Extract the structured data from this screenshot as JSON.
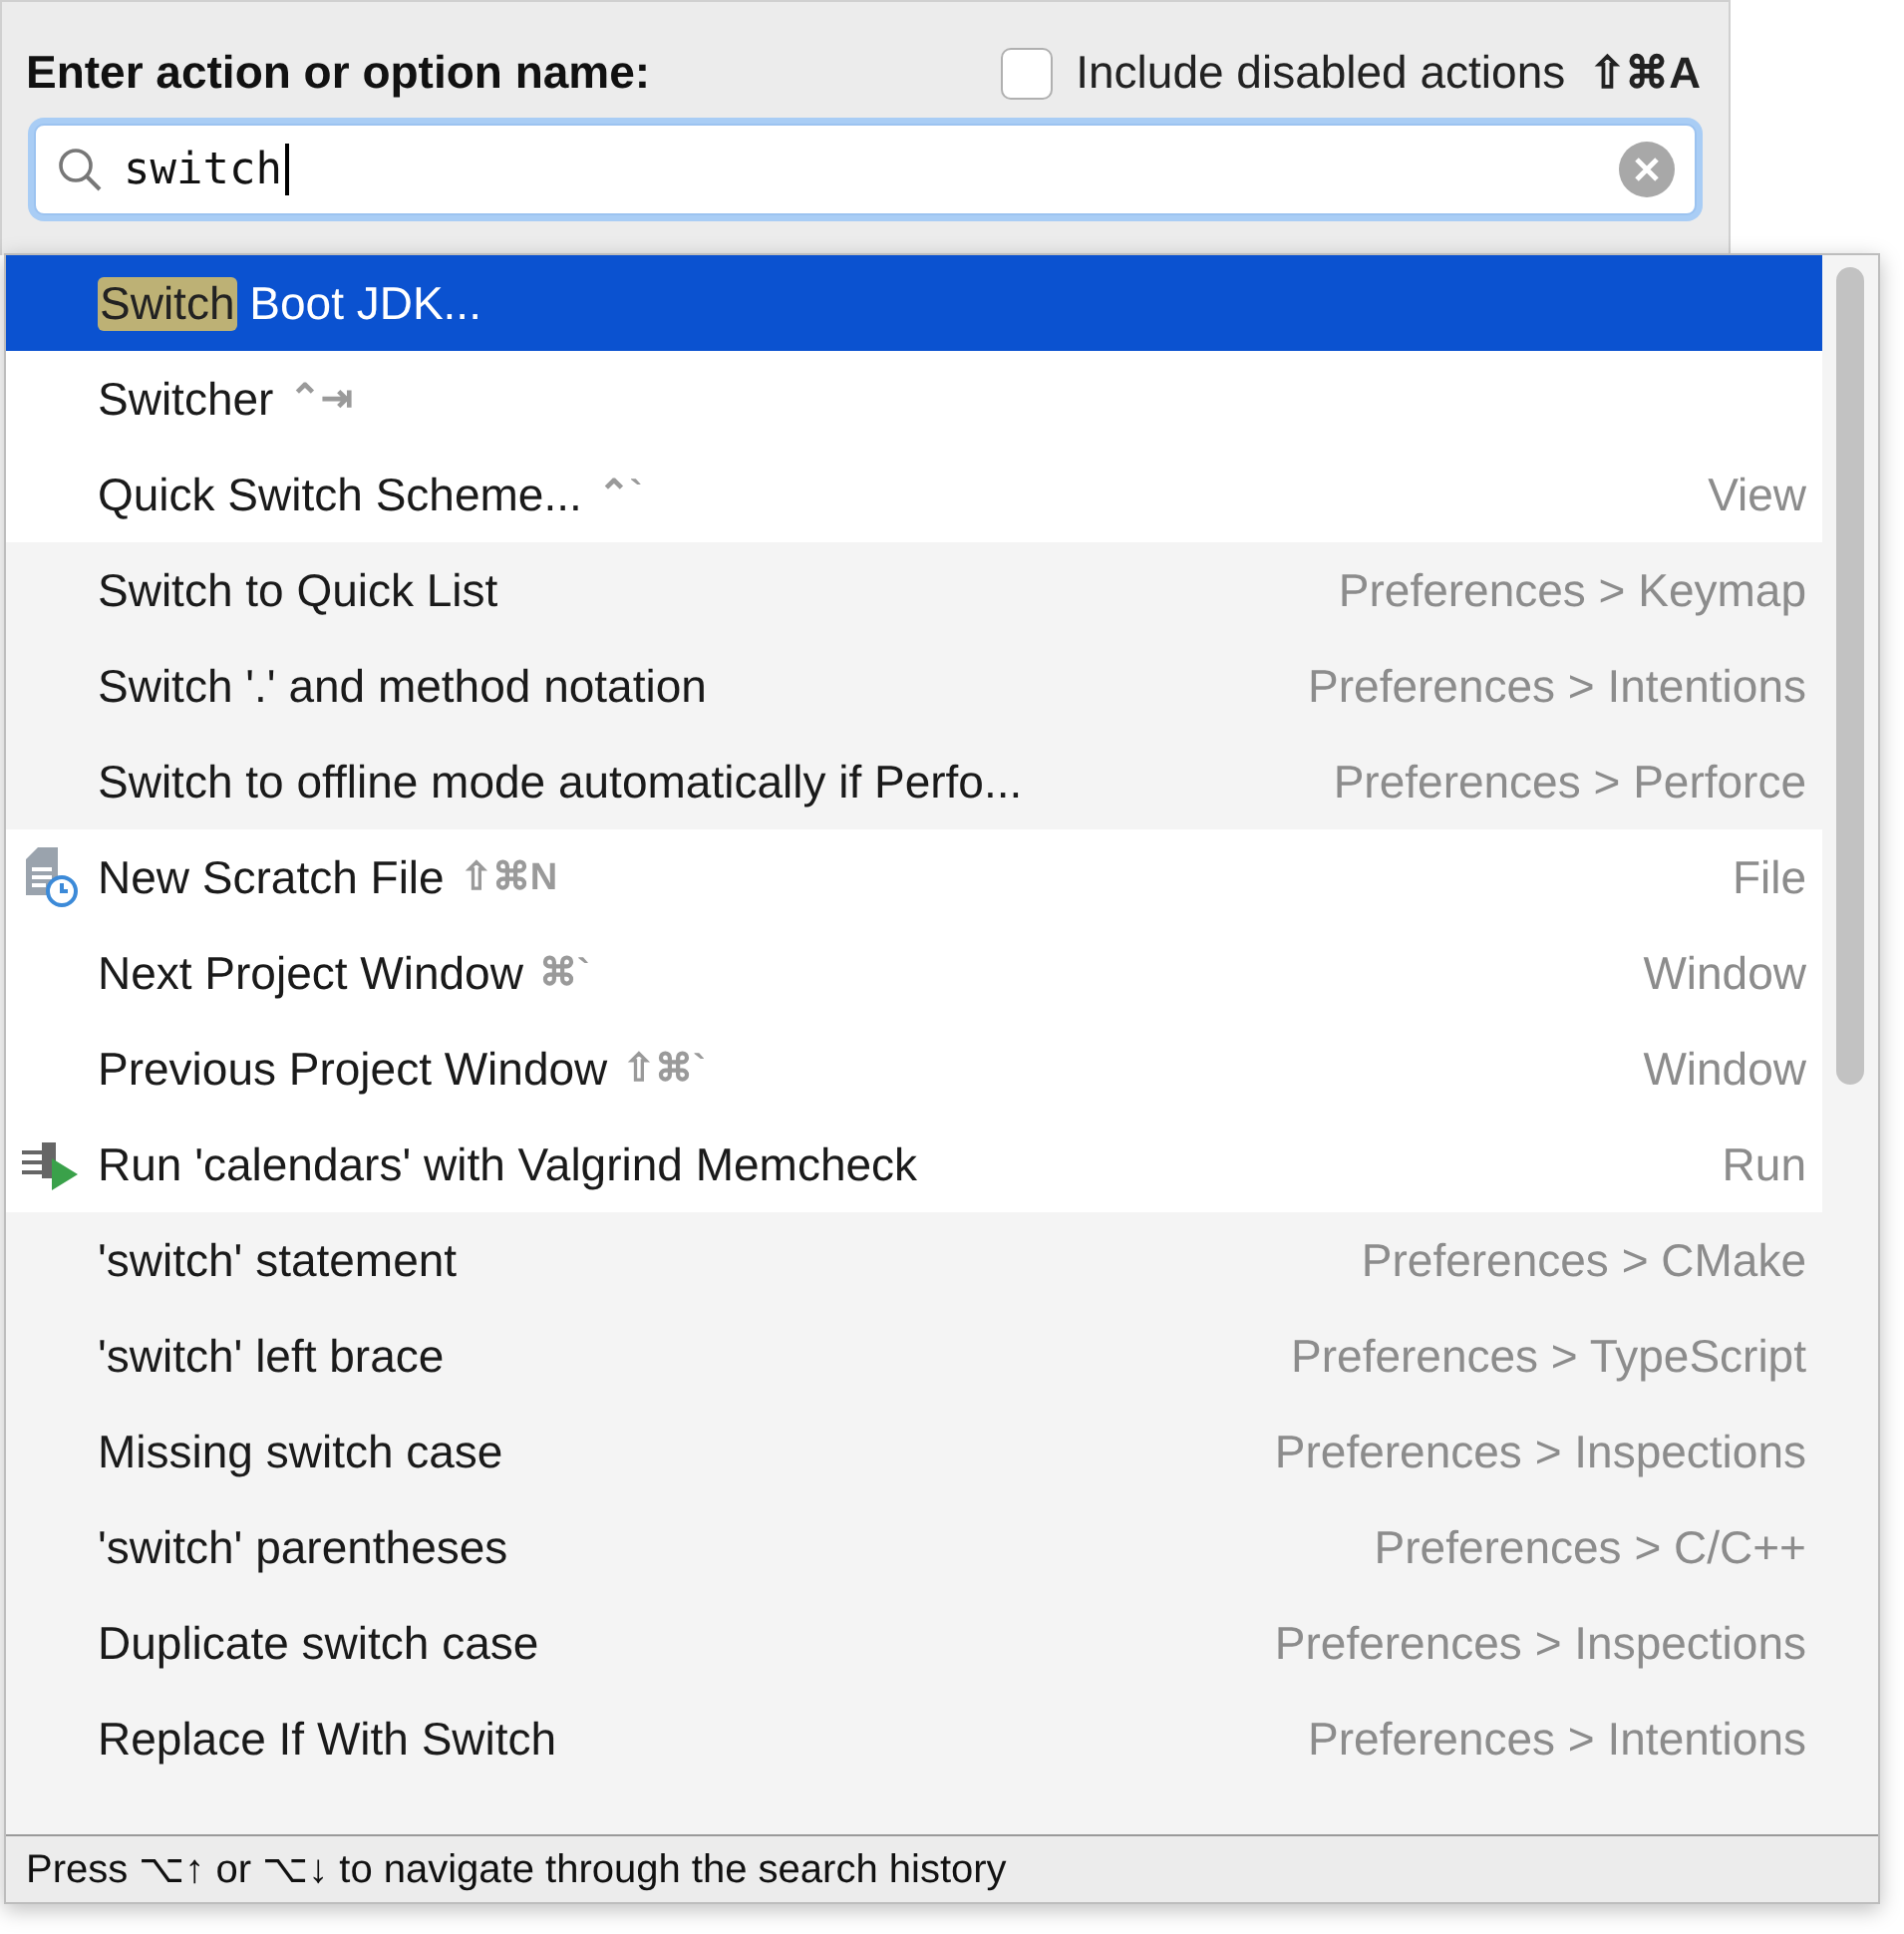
{
  "header": {
    "label": "Enter action or option name:",
    "include_disabled": {
      "label": "Include disabled actions",
      "checked": false,
      "shortcut": "⇧⌘A"
    }
  },
  "search": {
    "value": "switch"
  },
  "groups": [
    {
      "items": [
        {
          "kind": "plain",
          "match": "Switch",
          "label": " Boot JDK...",
          "selected": true
        },
        {
          "kind": "plain",
          "label": "Switcher",
          "shortcut": "⌃⇥",
          "selected": false
        },
        {
          "kind": "plain",
          "label": "Quick Switch Scheme...",
          "shortcut": "⌃`",
          "location": "View",
          "selected": false
        }
      ]
    },
    {
      "items": [
        {
          "kind": "plain",
          "label": "Switch to Quick List",
          "location": "Preferences > Keymap",
          "selected": false
        },
        {
          "kind": "plain",
          "label": "Switch '.' and method notation",
          "location": "Preferences > Intentions",
          "selected": false
        },
        {
          "kind": "plain",
          "label": "Switch to offline mode automatically if Perfo...",
          "location": "Preferences > Perforce",
          "selected": false
        }
      ]
    },
    {
      "items": [
        {
          "kind": "scratch",
          "label": "New Scratch File",
          "shortcut": "⇧⌘N",
          "location": "File",
          "selected": false
        },
        {
          "kind": "plain",
          "label": "Next Project Window",
          "shortcut": "⌘`",
          "location": "Window",
          "selected": false
        },
        {
          "kind": "plain",
          "label": "Previous Project Window",
          "shortcut": "⇧⌘`",
          "location": "Window",
          "selected": false
        },
        {
          "kind": "run",
          "label": "Run 'calendars' with Valgrind Memcheck",
          "location": "Run",
          "selected": false
        }
      ]
    },
    {
      "items": [
        {
          "kind": "plain",
          "label": "'switch' statement",
          "location": "Preferences > CMake",
          "selected": false
        },
        {
          "kind": "plain",
          "label": "'switch' left brace",
          "location": "Preferences > TypeScript",
          "selected": false
        },
        {
          "kind": "plain",
          "label": "Missing switch case",
          "location": "Preferences > Inspections",
          "selected": false
        },
        {
          "kind": "plain",
          "label": "'switch' parentheses",
          "location": "Preferences > C/C++",
          "selected": false
        },
        {
          "kind": "plain",
          "label": "Duplicate switch case",
          "location": "Preferences > Inspections",
          "selected": false
        },
        {
          "kind": "plain",
          "label": "Replace If With Switch",
          "location": "Preferences > Intentions",
          "selected": false
        }
      ]
    }
  ],
  "status_bar": "Press ⌥↑ or ⌥↓ to navigate through the search history"
}
